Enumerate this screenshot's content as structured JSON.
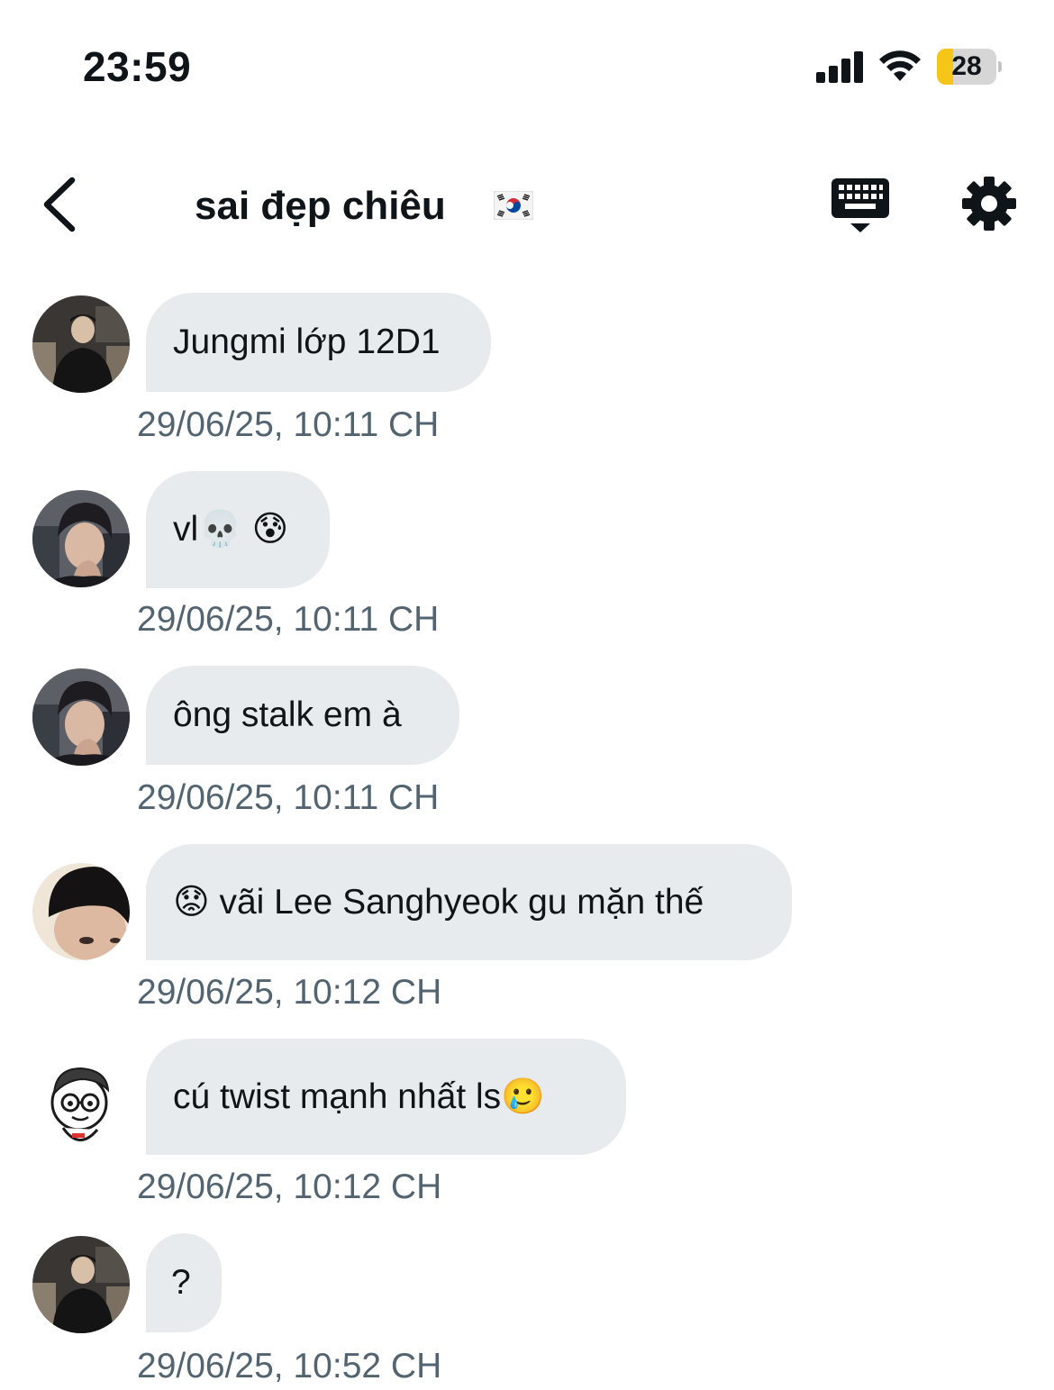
{
  "status_bar": {
    "time": "23:59",
    "battery_level": "28",
    "battery_fraction": 0.28,
    "icons": [
      "cellular-signal-icon",
      "wifi-icon",
      "battery-icon"
    ]
  },
  "header": {
    "title": "sai đẹp chiêu",
    "title_flag": "🇰🇷",
    "icons": [
      "back-chevron-icon",
      "keyboard-icon",
      "gear-icon"
    ]
  },
  "messages": [
    {
      "text": "Jungmi lớp 12D1",
      "timestamp": "29/06/25, 10:11 CH",
      "avatar": "avatar-dark-suit"
    },
    {
      "text": "vl💀 😰",
      "timestamp": "29/06/25, 10:11 CH",
      "avatar": "avatar-hand-face"
    },
    {
      "text": "ông stalk em à",
      "timestamp": "29/06/25, 10:11 CH",
      "avatar": "avatar-hand-face"
    },
    {
      "text": "😟 vãi Lee Sanghyeok gu mặn thế",
      "timestamp": "29/06/25, 10:12 CH",
      "avatar": "avatar-closeup"
    },
    {
      "text": "cú twist mạnh nhất ls🥲",
      "timestamp": "29/06/25, 10:12 CH",
      "avatar": "avatar-cartoon"
    },
    {
      "text": "?",
      "timestamp": "29/06/25, 10:52 CH",
      "avatar": "avatar-dark-suit"
    }
  ],
  "colors": {
    "bubble_bg": "#e8ebee",
    "timestamp": "#536471",
    "text": "#0f1419",
    "battery_fill": "#f5c518"
  }
}
